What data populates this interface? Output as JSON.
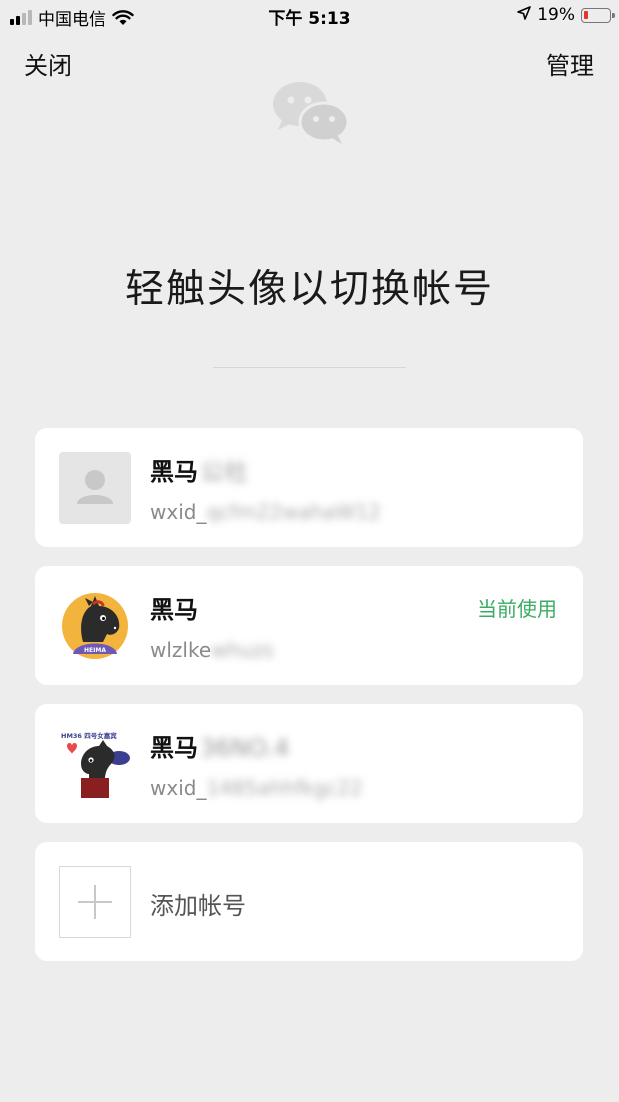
{
  "status_bar": {
    "carrier": "中国电信",
    "time": "下午 5:13",
    "battery": "19%",
    "battery_fraction": 0.19
  },
  "nav": {
    "close_label": "关闭",
    "manage_label": "管理"
  },
  "logo": {
    "icon": "wechat-logo-icon"
  },
  "headline": "轻触头像以切换帐号",
  "accounts": [
    {
      "name": "黑马",
      "name_blurred": "公社",
      "wxid_prefix": "wxid_",
      "wxid_blurred": "qcfm22wahaW12",
      "avatar": "default-user-icon"
    },
    {
      "name": "黑马",
      "name_blurred": "",
      "wxid_prefix": "wlzlke",
      "wxid_blurred": "whuzs",
      "avatar": "horse-heima-avatar",
      "avatar_text": "HEIMA",
      "status": "当前使用"
    },
    {
      "name": "黑马",
      "name_blurred": "36NO.4",
      "wxid_prefix": "wxid_",
      "wxid_blurred": "1485ahhfkgc22",
      "avatar": "horse-hm36-avatar",
      "avatar_text": "HM36 四号女嘉宾"
    }
  ],
  "add_account": {
    "label": "添加帐号",
    "icon": "plus-icon"
  },
  "colors": {
    "background": "#ededed",
    "card": "#ffffff",
    "accent_green": "#3aad62",
    "battery_red": "#e8322b"
  }
}
